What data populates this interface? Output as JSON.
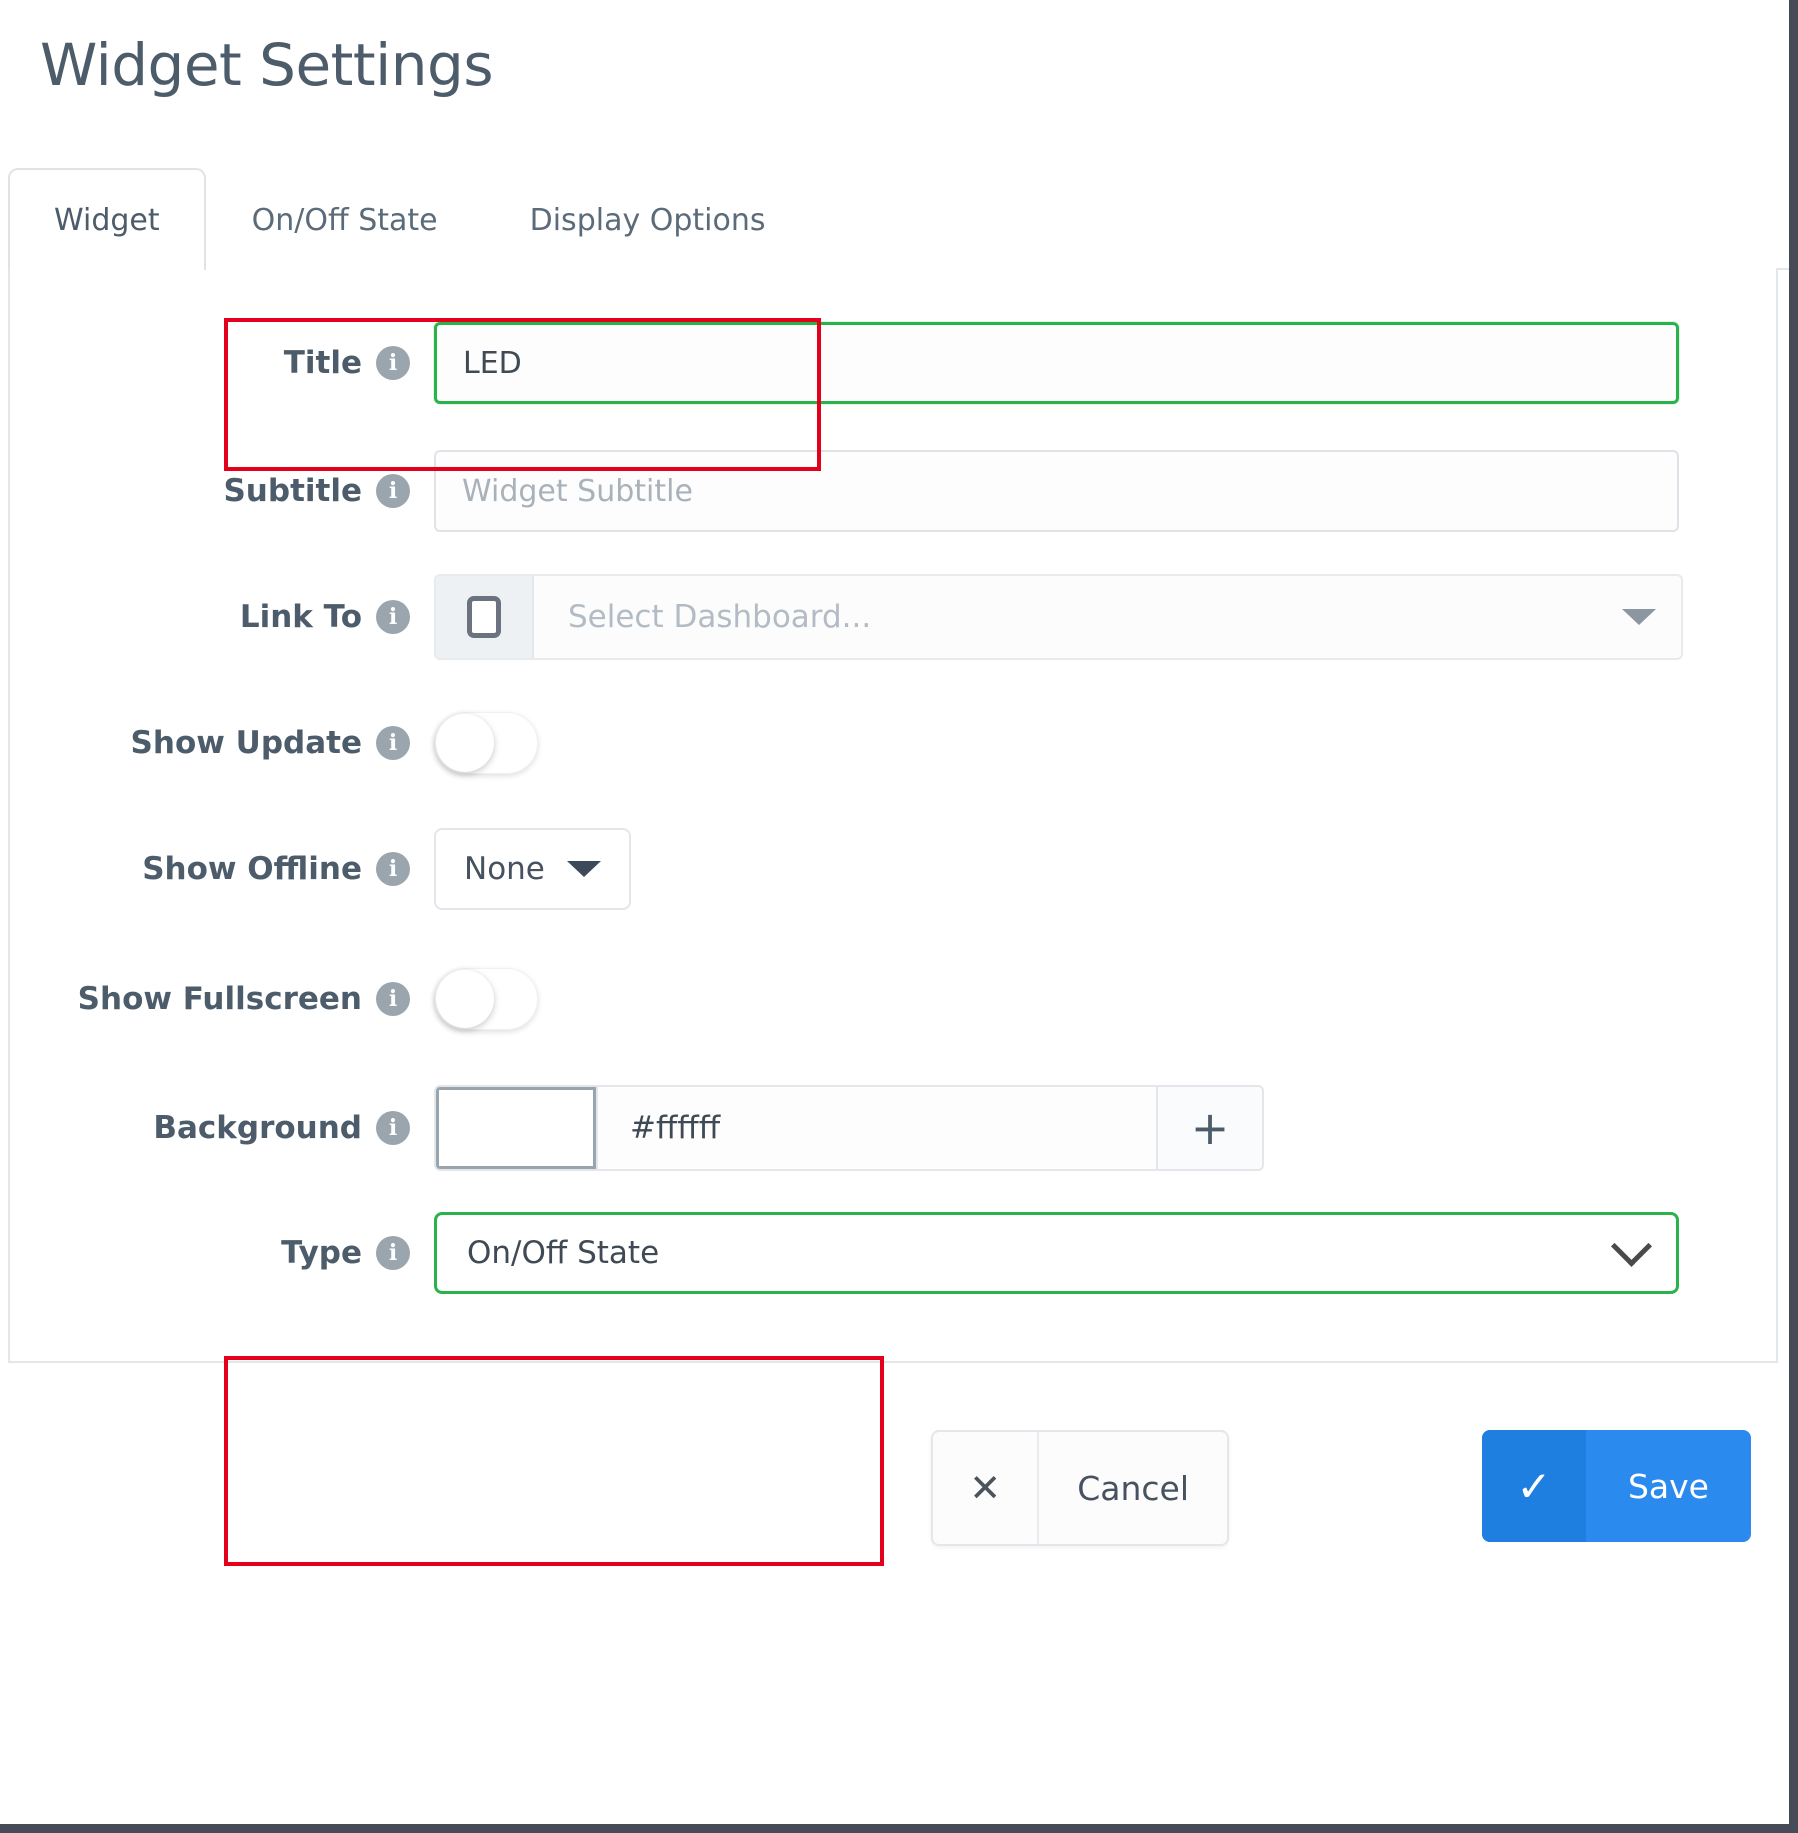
{
  "page": {
    "title": "Widget Settings"
  },
  "tabs": [
    {
      "label": "Widget",
      "active": true
    },
    {
      "label": "On/Off State",
      "active": false
    },
    {
      "label": "Display Options",
      "active": false
    }
  ],
  "form": {
    "title": {
      "label": "Title",
      "value": "LED",
      "info_icon": "info-icon"
    },
    "subtitle": {
      "label": "Subtitle",
      "value": "",
      "placeholder": "Widget Subtitle",
      "info_icon": "info-icon"
    },
    "link_to": {
      "label": "Link To",
      "placeholder": "Select Dashboard...",
      "prefix_icon": "tablet-icon",
      "caret_icon": "triangle-down-icon",
      "info_icon": "info-icon"
    },
    "show_update": {
      "label": "Show Update",
      "state": "off",
      "info_icon": "info-icon"
    },
    "show_offline": {
      "label": "Show Offline",
      "value": "None",
      "caret_icon": "triangle-down-icon",
      "info_icon": "info-icon"
    },
    "show_fullscreen": {
      "label": "Show Fullscreen",
      "state": "off",
      "info_icon": "info-icon"
    },
    "background": {
      "label": "Background",
      "swatch_color": "#ffffff",
      "value": "#ffffff",
      "add_label": "+",
      "info_icon": "info-icon"
    },
    "type": {
      "label": "Type",
      "value": "On/Off State",
      "chevron_icon": "chevron-down-icon",
      "info_icon": "info-icon"
    }
  },
  "footer": {
    "cancel_label": "Cancel",
    "cancel_icon": "✕",
    "save_label": "Save",
    "save_icon": "✓"
  },
  "colors": {
    "highlight_green": "#2ab34a",
    "annotation_red": "#e3001b",
    "save_blue": "#2b8aee",
    "save_blue_dark": "#1f7fe0",
    "label_text": "#4d5c6b",
    "frame_dark": "#464b57"
  }
}
